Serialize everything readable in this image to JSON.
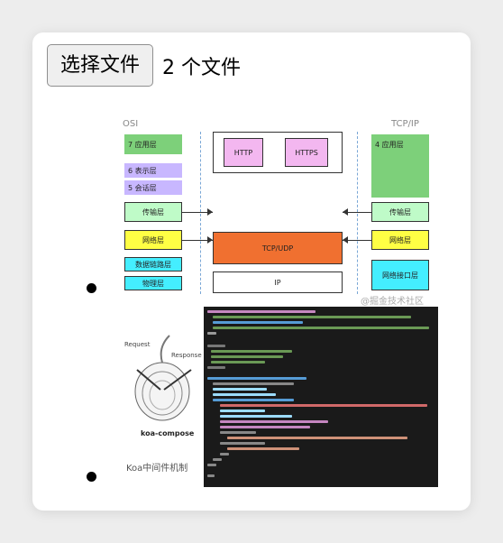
{
  "file_input": {
    "button_label": "选择文件",
    "count_text": "2 个文件"
  },
  "osi_image": {
    "osi_header": "OSI",
    "tcpip_header": "TCP/IP",
    "osi_layers": {
      "application": "7 应用层",
      "presentation": "6 表示层",
      "session": "5 会话层",
      "transport": "传输层",
      "network": "网络层",
      "datalink": "数据链路层",
      "physical": "物理层"
    },
    "protocols": {
      "http": "HTTP",
      "https": "HTTPS",
      "tcp_udp": "TCP/UDP",
      "ip": "IP"
    },
    "tcpip_layers": {
      "application": "4 应用层",
      "transport": "传输层",
      "network": "网络层",
      "link": "网络接口层"
    },
    "watermark": "@掘金技术社区"
  },
  "koa_image": {
    "request_label": "Request",
    "response_label": "Response",
    "logo_text": "koa-compose",
    "caption": "Koa中间件机制"
  },
  "colors": {
    "green": "#7dd07a",
    "purple": "#c8b7ff",
    "orange": "#f07030",
    "mint": "#bffbc8",
    "yellow": "#ffff44",
    "cyan": "#44eeff",
    "pink": "#f3b7f0"
  }
}
